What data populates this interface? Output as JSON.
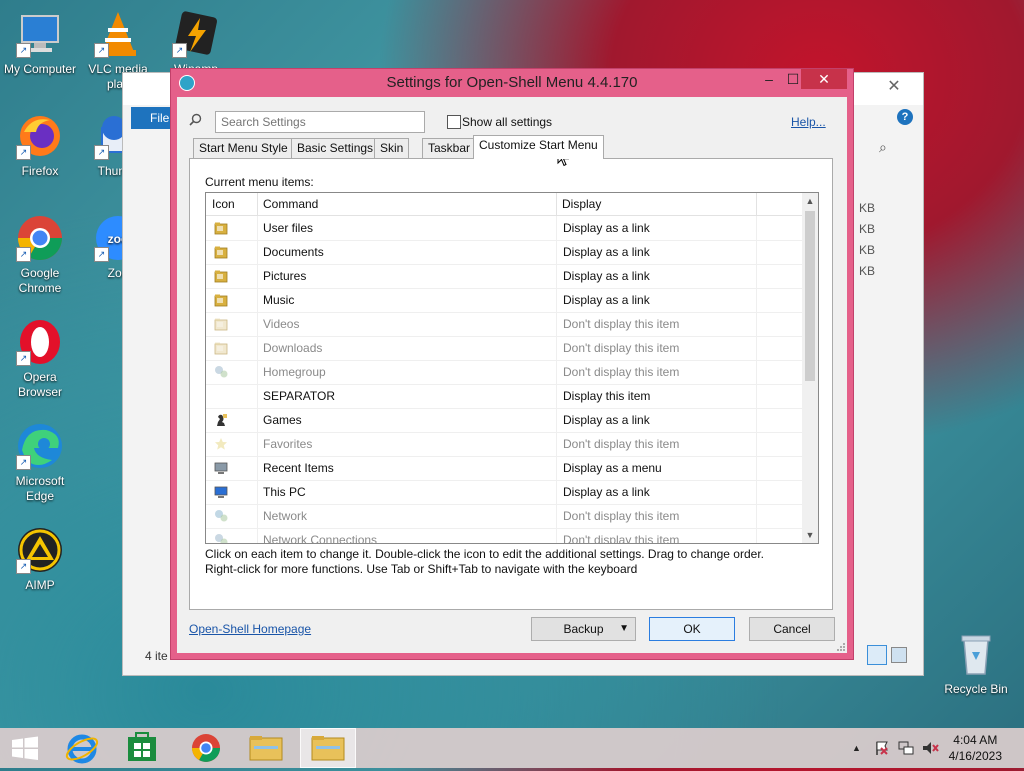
{
  "desktop": {
    "icons": [
      {
        "label": "My Computer",
        "icon": "computer-icon"
      },
      {
        "label": "VLC media play",
        "icon": "vlc-icon"
      },
      {
        "label": "Winamp",
        "icon": "winamp-icon"
      },
      {
        "label": "Firefox",
        "icon": "firefox-icon"
      },
      {
        "label": "Thunde",
        "icon": "thunderbird-icon"
      },
      {
        "label": "Google Chrome",
        "icon": "chrome-icon"
      },
      {
        "label": "Zoo",
        "icon": "zoom-icon"
      },
      {
        "label": "Opera Browser",
        "icon": "opera-icon"
      },
      {
        "label": "Microsoft Edge",
        "icon": "edge-icon"
      },
      {
        "label": "AIMP",
        "icon": "aimp-icon"
      },
      {
        "label": "Recycle Bin",
        "icon": "recycle-bin-icon"
      }
    ]
  },
  "explorer": {
    "file_tab": "File",
    "kb_labels": [
      "KB",
      "KB",
      "KB",
      "KB"
    ],
    "status": "4 ite"
  },
  "dialog": {
    "title": "Settings for Open-Shell Menu 4.4.170",
    "search_placeholder": "Search Settings",
    "show_all_label": "Show all settings",
    "help_link": "Help...",
    "tabs": [
      "Start Menu Style",
      "Basic Settings",
      "Skin",
      "Taskbar",
      "Customize Start Menu"
    ],
    "active_tab": "Customize Start Menu",
    "current_label": "Current menu items:",
    "columns": [
      "Icon",
      "Command",
      "Display"
    ],
    "rows": [
      {
        "command": "User files",
        "display": "Display as a link",
        "enabled": true,
        "icon": "user-folder-icon"
      },
      {
        "command": "Documents",
        "display": "Display as a link",
        "enabled": true,
        "icon": "documents-icon"
      },
      {
        "command": "Pictures",
        "display": "Display as a link",
        "enabled": true,
        "icon": "pictures-icon"
      },
      {
        "command": "Music",
        "display": "Display as a link",
        "enabled": true,
        "icon": "music-icon"
      },
      {
        "command": "Videos",
        "display": "Don't display this item",
        "enabled": false,
        "icon": "videos-icon"
      },
      {
        "command": "Downloads",
        "display": "Don't display this item",
        "enabled": false,
        "icon": "downloads-icon"
      },
      {
        "command": "Homegroup",
        "display": "Don't display this item",
        "enabled": false,
        "icon": "homegroup-icon"
      },
      {
        "command": "SEPARATOR",
        "display": "Display this item",
        "enabled": true,
        "icon": ""
      },
      {
        "command": "Games",
        "display": "Display as a link",
        "enabled": true,
        "icon": "games-icon"
      },
      {
        "command": "Favorites",
        "display": "Don't display this item",
        "enabled": false,
        "icon": "favorites-star-icon"
      },
      {
        "command": "Recent Items",
        "display": "Display as a menu",
        "enabled": true,
        "icon": "recent-items-icon"
      },
      {
        "command": "This PC",
        "display": "Display as a link",
        "enabled": true,
        "icon": "this-pc-icon"
      },
      {
        "command": "Network",
        "display": "Don't display this item",
        "enabled": false,
        "icon": "network-icon"
      },
      {
        "command": "Network Connections",
        "display": "Don't display this item",
        "enabled": false,
        "icon": "network-connections-icon"
      }
    ],
    "hint_line1": "Click on each item to change it. Double-click the icon to edit the additional settings. Drag to change order.",
    "hint_line2": "Right-click for more functions. Use Tab or Shift+Tab to navigate with the keyboard",
    "homepage_link": "Open-Shell Homepage",
    "backup_label": "Backup",
    "ok_label": "OK",
    "cancel_label": "Cancel"
  },
  "taskbar": {
    "time": "4:04 AM",
    "date": "4/16/2023"
  },
  "colors": {
    "dialog_frame": "#e5608a",
    "close_red": "#c7324a",
    "link_blue": "#1a55a8",
    "taskbar": "#dccdcd"
  }
}
